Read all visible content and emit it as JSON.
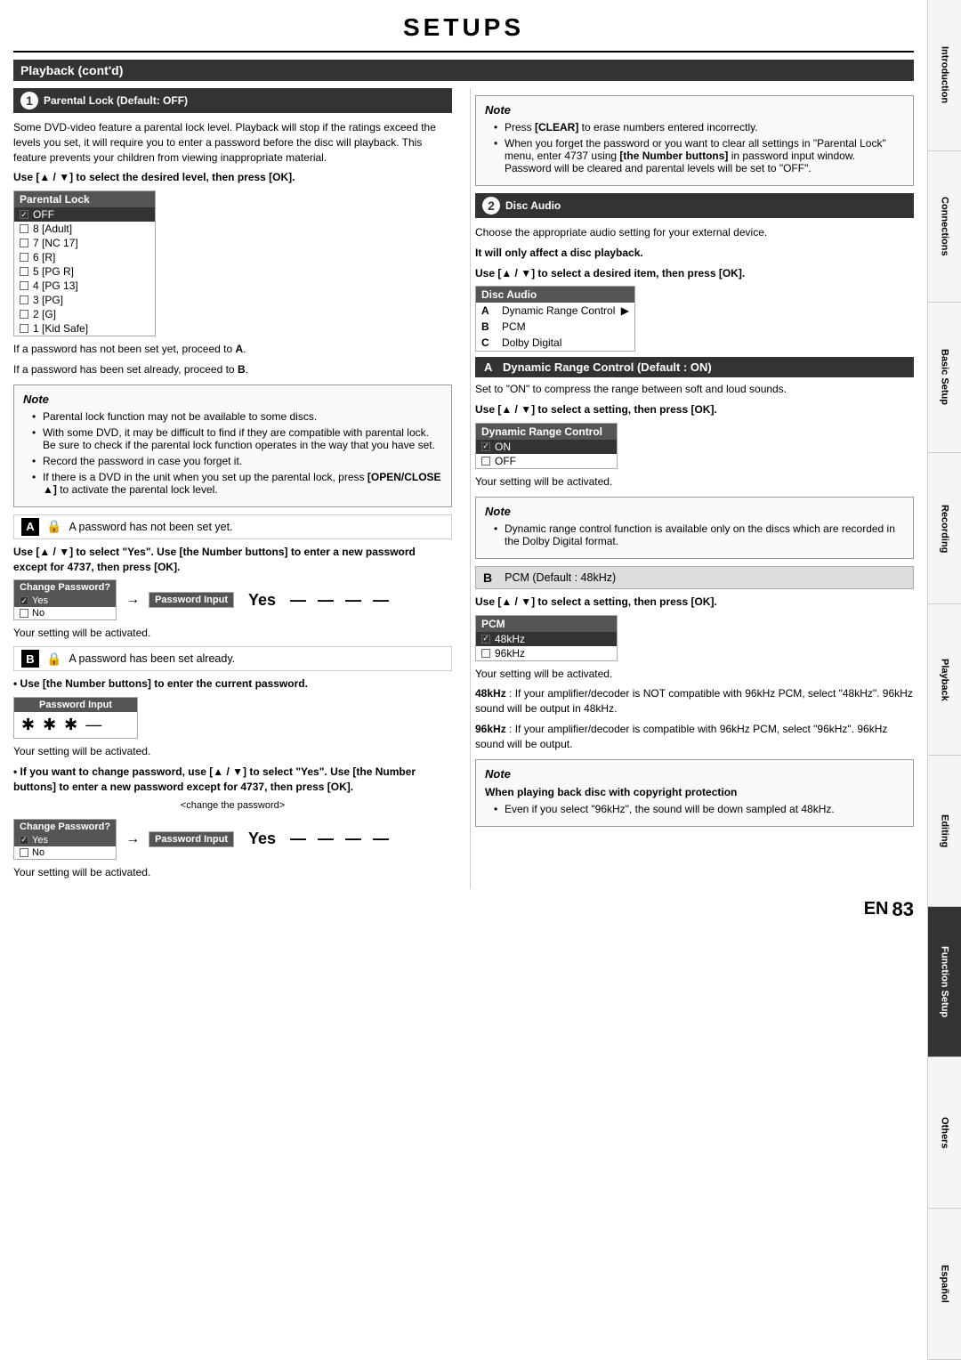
{
  "page": {
    "title": "SETUPS",
    "page_number": "83",
    "en_label": "EN"
  },
  "right_tabs": [
    {
      "label": "Introduction",
      "active": false
    },
    {
      "label": "Connections",
      "active": false
    },
    {
      "label": "Basic Setup",
      "active": false
    },
    {
      "label": "Recording",
      "active": false
    },
    {
      "label": "Playback",
      "active": false
    },
    {
      "label": "Editing",
      "active": false
    },
    {
      "label": "Function Setup",
      "active": true
    },
    {
      "label": "Others",
      "active": false
    },
    {
      "label": "Español",
      "active": false
    }
  ],
  "section_header": "Playback (cont'd)",
  "section1": {
    "number": "1",
    "title": "Parental Lock (Default: OFF)",
    "description": "Some DVD-video feature a parental lock level. Playback will stop if the ratings exceed the levels you set, it will require you to enter a password before the disc will playback. This feature prevents your children from viewing inappropriate material.",
    "instruction1": "Use [▲ / ▼] to select the desired level, then press [OK].",
    "parental_lock_table": {
      "header": "Parental Lock",
      "rows": [
        {
          "label": "OFF",
          "checked": true,
          "selected": true
        },
        {
          "label": "8 [Adult]",
          "checked": false
        },
        {
          "label": "7 [NC 17]",
          "checked": false
        },
        {
          "label": "6 [R]",
          "checked": false
        },
        {
          "label": "5 [PG R]",
          "checked": false
        },
        {
          "label": "4 [PG 13]",
          "checked": false
        },
        {
          "label": "3 [PG]",
          "checked": false
        },
        {
          "label": "2 [G]",
          "checked": false
        },
        {
          "label": "1 [Kid Safe]",
          "checked": false
        }
      ]
    },
    "proceed_a": "If a password has not been set yet, proceed to",
    "proceed_a_label": "A",
    "proceed_b": "If a password has been set already, proceed to",
    "proceed_b_label": "B",
    "note": {
      "title": "Note",
      "items": [
        "Parental lock function may not be available to some discs.",
        "With some DVD, it may be difficult to find if they are compatible with parental lock. Be sure to check if the parental lock function operates in the way that you have set.",
        "Record the password in case you forget it.",
        "If there is a DVD in the unit when you set up the parental lock, press [OPEN/CLOSE ▲] to activate the parental lock level."
      ]
    },
    "block_a": {
      "icon": "🔒",
      "text": "A password has not been set yet."
    },
    "instruction2": "Use [▲ / ▼] to select \"Yes\". Use [the Number buttons] to enter a new password except for 4737, then press [OK].",
    "change_pwd_box": {
      "header": "Change Password?",
      "yes_label": "Yes",
      "no_label": "No",
      "yes_selected": true
    },
    "yes_text": "Yes",
    "pwd_input_label": "Password Input",
    "pwd_input_dashes": "— — — —",
    "setting_activated1": "Your setting will be activated.",
    "block_b": {
      "icon": "🔒",
      "text": "A password has been set already."
    },
    "enter_password_instruction": "Use [the Number buttons] to enter the current password.",
    "pwd_input2": {
      "label": "Password Input",
      "stars": "✱  ✱  ✱  —"
    },
    "setting_activated2": "Your setting will be activated.",
    "change_instruction": "If you want to change password, use [▲ / ▼] to select \"Yes\". Use [the Number buttons] to enter a new password except for 4737, then press [OK].",
    "change_password_label": "<change the password>",
    "change_pwd_box2": {
      "header": "Change Password?",
      "yes_label": "Yes",
      "no_label": "No",
      "yes_selected": true
    },
    "yes_text2": "Yes",
    "pwd_input3": {
      "label": "Password Input",
      "dashes": "— — — —"
    },
    "setting_activated3": "Your setting will be activated."
  },
  "section1_note": {
    "title": "Note",
    "items": [
      "Press [CLEAR] to erase numbers entered incorrectly.",
      "When you forget the password or you want to clear all settings in \"Parental Lock\" menu, enter 4737 using [the Number buttons] in password input window. Password will be cleared and parental levels will be set to \"OFF\"."
    ]
  },
  "section2": {
    "number": "2",
    "title": "Disc Audio",
    "description": "Choose the appropriate audio setting for your external device.",
    "bold_note": "It will only affect a disc playback.",
    "instruction": "Use [▲ / ▼] to select a desired item, then press [OK].",
    "disc_audio_table": {
      "header": "Disc Audio",
      "rows": [
        {
          "label": "A",
          "text": "Dynamic Range Control"
        },
        {
          "label": "B",
          "text": "PCM"
        },
        {
          "label": "C",
          "text": "Dolby Digital"
        }
      ]
    },
    "block_a": {
      "text": "Dynamic Range Control (Default : ON)"
    },
    "block_a_description": "Set to \"ON\" to compress the range between soft and loud sounds.",
    "instruction_a": "Use [▲ / ▼] to select a setting, then press [OK].",
    "dynamic_range_table": {
      "header": "Dynamic Range Control",
      "rows": [
        {
          "label": "ON",
          "checked": true,
          "selected": true
        },
        {
          "label": "OFF",
          "checked": false
        }
      ]
    },
    "setting_activated_a": "Your setting will be activated.",
    "note_a": {
      "title": "Note",
      "items": [
        "Dynamic range control function is available only on the discs which are recorded in the Dolby Digital format."
      ]
    },
    "block_b": {
      "text": "PCM (Default : 48kHz)"
    },
    "instruction_b": "Use [▲ / ▼] to select a setting, then press [OK].",
    "pcm_table": {
      "header": "PCM",
      "rows": [
        {
          "label": "48kHz",
          "checked": true,
          "selected": true
        },
        {
          "label": "96kHz",
          "checked": false
        }
      ]
    },
    "setting_activated_b": "Your setting will be activated.",
    "khz_48": "48kHz",
    "khz_48_desc": ": If your amplifier/decoder is NOT compatible with 96kHz PCM, select \"48kHz\". 96kHz sound will be output in 48kHz.",
    "khz_96": "96kHz",
    "khz_96_desc": ": If your amplifier/decoder is compatible with 96kHz PCM, select \"96kHz\". 96kHz sound will be output.",
    "note_b": {
      "title": "Note",
      "bold_title": "When playing back disc with copyright protection",
      "items": [
        "Even if you select \"96kHz\", the sound will be down sampled at 48kHz."
      ]
    }
  }
}
